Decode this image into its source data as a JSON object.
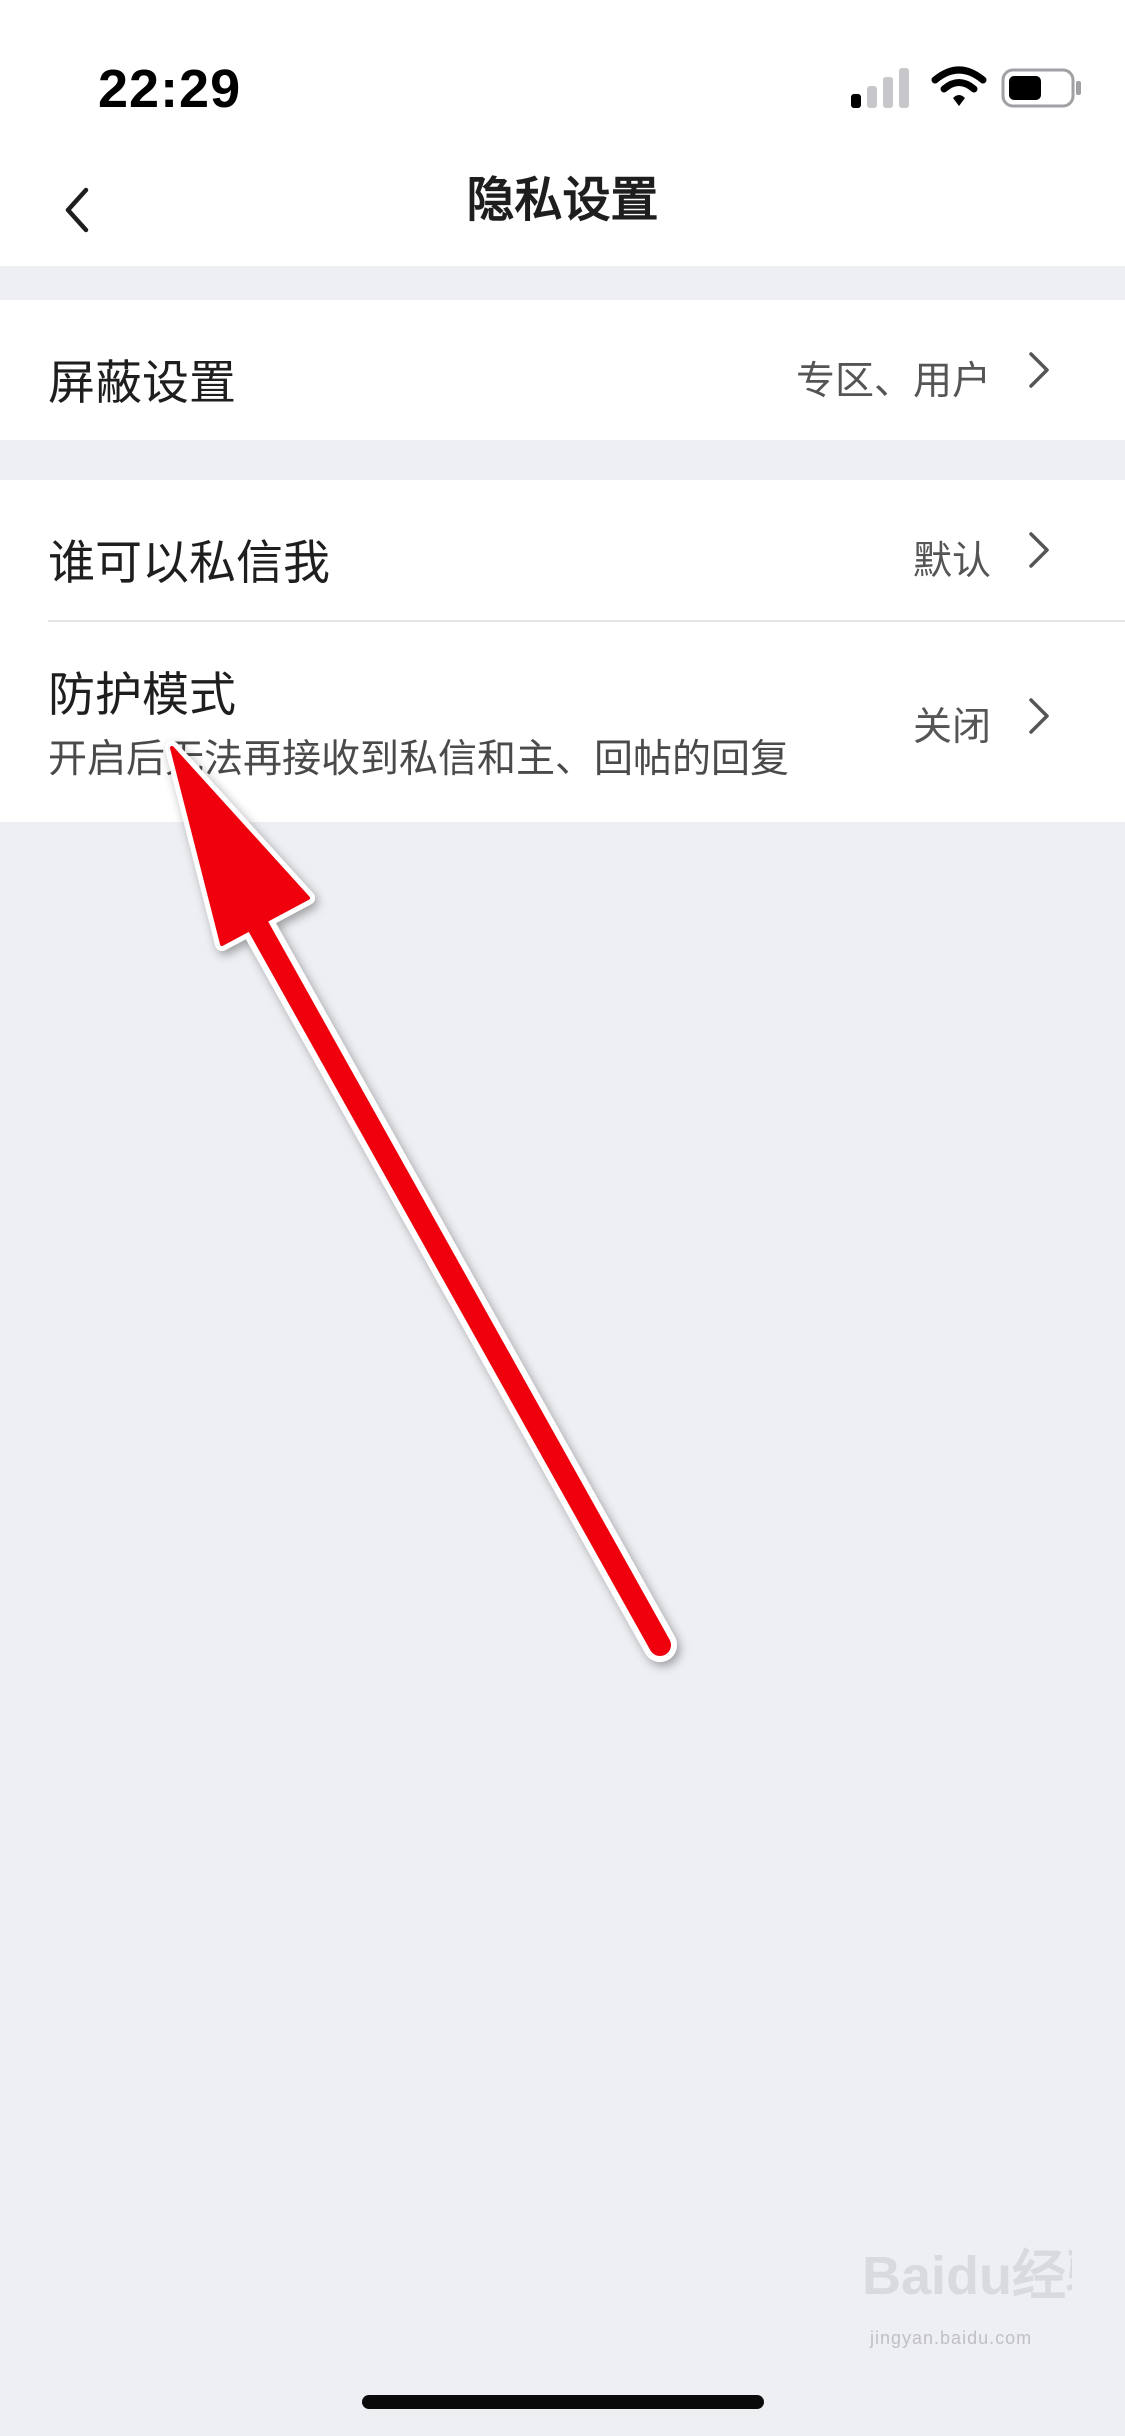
{
  "status_bar": {
    "time": "22:29",
    "icons": [
      "signal-icon",
      "wifi-icon",
      "battery-icon"
    ]
  },
  "nav": {
    "title": "隐私设置",
    "back_icon": "chevron-left-icon"
  },
  "groups": [
    {
      "items": [
        {
          "label": "屏蔽设置",
          "value": "专区、用户",
          "icon": "chevron-right-icon"
        }
      ]
    },
    {
      "items": [
        {
          "label": "谁可以私信我",
          "value": "默认",
          "icon": "chevron-right-icon"
        },
        {
          "label": "防护模式",
          "value": "关闭",
          "subtitle": "开启后无法再接收到私信和主、回帖的回复",
          "icon": "chevron-right-icon"
        }
      ]
    }
  ],
  "annotation": {
    "type": "arrow-icon",
    "color": "#F0000A"
  },
  "watermark": {
    "text": "Baidu经验",
    "subtext": "jingyan.baidu.com"
  },
  "colors": {
    "background": "#EEEFF3",
    "surface": "#FFFFFF",
    "primary_text": "#1E1E1E",
    "secondary_text": "#555555"
  }
}
